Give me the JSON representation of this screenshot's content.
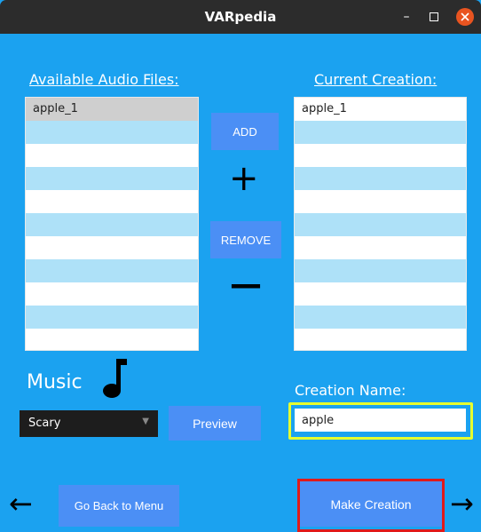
{
  "window": {
    "title": "VARpedia",
    "minimize": "–",
    "maximize": "◻",
    "close": "✕"
  },
  "available": {
    "heading": "Available Audio Files:",
    "items": [
      "apple_1",
      "",
      "",
      "",
      "",
      "",
      "",
      "",
      "",
      "",
      ""
    ]
  },
  "current": {
    "heading": "Current Creation:",
    "items": [
      "apple_1",
      "",
      "",
      "",
      "",
      "",
      "",
      "",
      "",
      "",
      ""
    ]
  },
  "buttons": {
    "add": "ADD",
    "add_symbol": "+",
    "remove": "REMOVE",
    "remove_symbol": "—",
    "preview": "Preview",
    "back": "Go Back to Menu",
    "make": "Make Creation"
  },
  "music": {
    "label": "Music",
    "icon": "music-note-icon",
    "selected": "Scary"
  },
  "creation_name": {
    "label": "Creation Name:",
    "value": "apple"
  },
  "nav": {
    "back_arrow": "←",
    "forward_arrow": "→"
  }
}
